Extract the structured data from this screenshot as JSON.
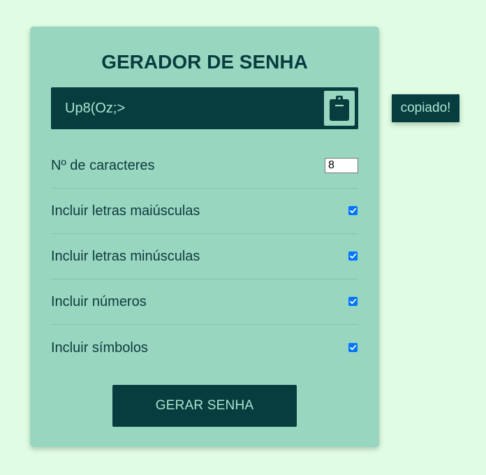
{
  "app": {
    "title": "GERADOR DE SENHA"
  },
  "result": {
    "password": "Up8(Oz;>",
    "copy_icon": "clipboard-icon"
  },
  "options": {
    "length_label": "Nº de caracteres",
    "length_value": "8",
    "uppercase_label": "Incluir letras maiúsculas",
    "uppercase_checked": true,
    "lowercase_label": "Incluir letras minúsculas",
    "lowercase_checked": true,
    "numbers_label": "Incluir números",
    "numbers_checked": true,
    "symbols_label": "Incluir símbolos",
    "symbols_checked": true
  },
  "actions": {
    "generate_label": "GERAR SENHA"
  },
  "toast": {
    "message": "copiado!"
  },
  "colors": {
    "background": "#e0fde4",
    "card": "#99d6c0",
    "dark": "#073d3f",
    "accent_text": "#a8e6cf",
    "checkbox": "#0075ff"
  }
}
